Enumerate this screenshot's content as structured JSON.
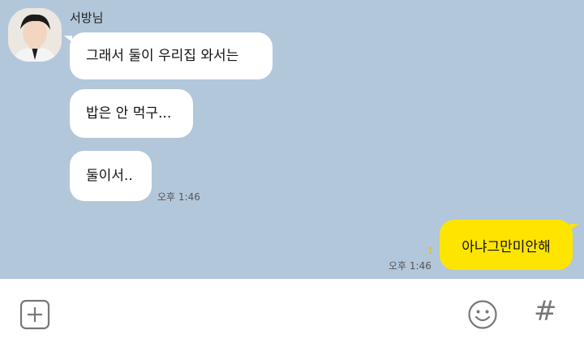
{
  "chat": {
    "sender_name": "서방님",
    "messages": [
      {
        "text": "그래서 둘이 우리집 와서는"
      },
      {
        "text": "밥은 안 먹구..."
      },
      {
        "text": "둘이서.."
      }
    ],
    "received_time": "오후 1:46",
    "sent_message": "아냐그만미안해",
    "unread_count": "1",
    "sent_time": "오후 1:46"
  },
  "input_bar": {
    "plus_icon": "plus-square-icon",
    "emoji_icon": "smiley-icon",
    "hash_label": "#"
  },
  "colors": {
    "chat_background": "#b2c7da",
    "sent_bubble": "#fee500",
    "received_bubble": "#ffffff"
  }
}
